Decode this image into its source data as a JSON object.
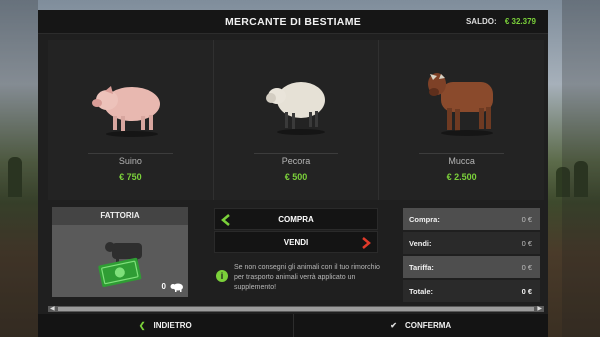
{
  "header": {
    "title": "MERCANTE DI BESTIAME",
    "saldo_label": "SALDO:",
    "saldo_value": "€ 32.379"
  },
  "animals": [
    {
      "name": "Suino",
      "price": "€ 750"
    },
    {
      "name": "Pecora",
      "price": "€ 500"
    },
    {
      "name": "Mucca",
      "price": "€ 2.500"
    }
  ],
  "fattoria": {
    "title": "FATTORIA",
    "count": "0"
  },
  "actions": {
    "compra": "COMPRA",
    "vendi": "VENDI"
  },
  "info": {
    "text": "Se non consegni gli animali con il tuo rimorchio per trasporto animali verrà applicato un supplemento!"
  },
  "summary": {
    "compra_label": "Compra:",
    "compra_value": "0 €",
    "vendi_label": "Vendi:",
    "vendi_value": "0 €",
    "tariffa_label": "Tariffa:",
    "tariffa_value": "0 €",
    "totale_label": "Totale:",
    "totale_value": "0 €"
  },
  "footer": {
    "back": "INDIETRO",
    "confirm": "CONFERMA"
  },
  "colors": {
    "accent_green": "#7bd13a",
    "arrow_red": "#e03a2a"
  }
}
